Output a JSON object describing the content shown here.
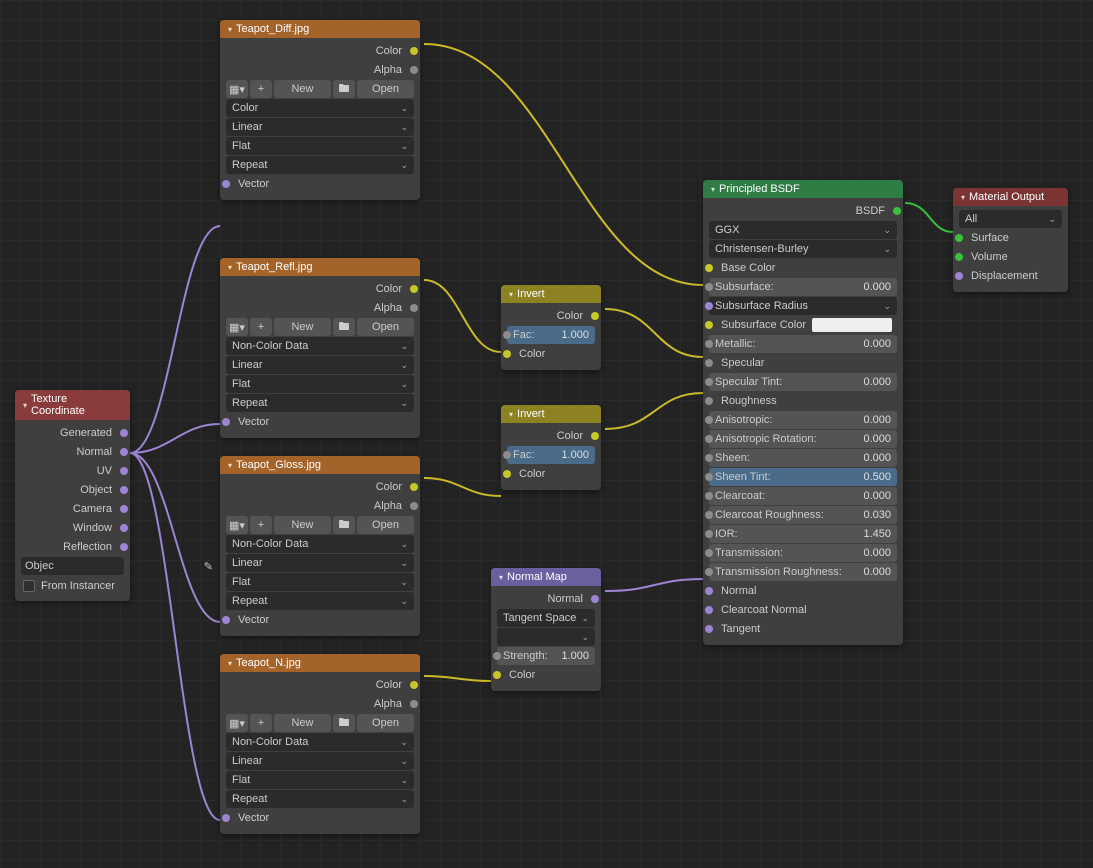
{
  "texcoord": {
    "title": "Texture Coordinate",
    "outputs": [
      "Generated",
      "Normal",
      "UV",
      "Object",
      "Camera",
      "Window",
      "Reflection"
    ],
    "object_label": "Objec",
    "from_instancer": "From Instancer"
  },
  "tex_diff": {
    "title": "Teapot_Diff.jpg",
    "outputs": [
      "Color",
      "Alpha"
    ],
    "btn_new": "New",
    "btn_open": "Open",
    "drops": [
      "Color",
      "Linear",
      "Flat",
      "Repeat"
    ],
    "vector": "Vector"
  },
  "tex_refl": {
    "title": "Teapot_Refl.jpg",
    "outputs": [
      "Color",
      "Alpha"
    ],
    "btn_new": "New",
    "btn_open": "Open",
    "drops": [
      "Non-Color Data",
      "Linear",
      "Flat",
      "Repeat"
    ],
    "vector": "Vector"
  },
  "tex_gloss": {
    "title": "Teapot_Gloss.jpg",
    "outputs": [
      "Color",
      "Alpha"
    ],
    "btn_new": "New",
    "btn_open": "Open",
    "drops": [
      "Non-Color Data",
      "Linear",
      "Flat",
      "Repeat"
    ],
    "vector": "Vector"
  },
  "tex_n": {
    "title": "Teapot_N.jpg",
    "outputs": [
      "Color",
      "Alpha"
    ],
    "btn_new": "New",
    "btn_open": "Open",
    "drops": [
      "Non-Color Data",
      "Linear",
      "Flat",
      "Repeat"
    ],
    "vector": "Vector"
  },
  "invert1": {
    "title": "Invert",
    "out_color": "Color",
    "fac_label": "Fac:",
    "fac_value": "1.000",
    "in_color": "Color"
  },
  "invert2": {
    "title": "Invert",
    "out_color": "Color",
    "fac_label": "Fac:",
    "fac_value": "1.000",
    "in_color": "Color"
  },
  "normalmap": {
    "title": "Normal Map",
    "out_normal": "Normal",
    "space": "Tangent Space",
    "uv": "",
    "strength_label": "Strength:",
    "strength_value": "1.000",
    "in_color": "Color"
  },
  "bsdf": {
    "title": "Principled BSDF",
    "out_bsdf": "BSDF",
    "dist": "GGX",
    "sss": "Christensen-Burley",
    "base_color": "Base Color",
    "subsurface": {
      "l": "Subsurface:",
      "v": "0.000"
    },
    "subsurface_radius": "Subsurface Radius",
    "subsurface_color": "Subsurface Color",
    "metallic": {
      "l": "Metallic:",
      "v": "0.000"
    },
    "specular": "Specular",
    "specular_tint": {
      "l": "Specular Tint:",
      "v": "0.000"
    },
    "roughness": "Roughness",
    "anisotropic": {
      "l": "Anisotropic:",
      "v": "0.000"
    },
    "aniso_rot": {
      "l": "Anisotropic Rotation:",
      "v": "0.000"
    },
    "sheen": {
      "l": "Sheen:",
      "v": "0.000"
    },
    "sheen_tint": {
      "l": "Sheen Tint:",
      "v": "0.500"
    },
    "clearcoat": {
      "l": "Clearcoat:",
      "v": "0.000"
    },
    "clearcoat_rough": {
      "l": "Clearcoat Roughness:",
      "v": "0.030"
    },
    "ior": {
      "l": "IOR:",
      "v": "1.450"
    },
    "transmission": {
      "l": "Transmission:",
      "v": "0.000"
    },
    "trans_rough": {
      "l": "Transmission Roughness:",
      "v": "0.000"
    },
    "normal": "Normal",
    "cc_normal": "Clearcoat Normal",
    "tangent": "Tangent"
  },
  "output": {
    "title": "Material Output",
    "target": "All",
    "surface": "Surface",
    "volume": "Volume",
    "displacement": "Displacement"
  }
}
